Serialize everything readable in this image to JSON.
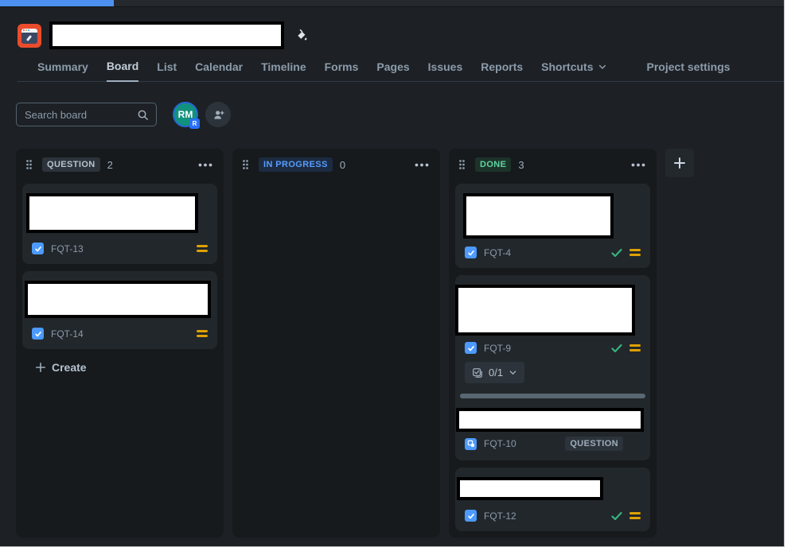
{
  "header": {
    "tabs": [
      {
        "label": "Summary"
      },
      {
        "label": "Board"
      },
      {
        "label": "List"
      },
      {
        "label": "Calendar"
      },
      {
        "label": "Timeline"
      },
      {
        "label": "Forms"
      },
      {
        "label": "Pages"
      },
      {
        "label": "Issues"
      },
      {
        "label": "Reports"
      },
      {
        "label": "Shortcuts"
      },
      {
        "label": "Project settings"
      }
    ],
    "active_tab": "Board"
  },
  "toolbar": {
    "search_placeholder": "Search board",
    "avatar_initials": "RM",
    "avatar_badge": "R"
  },
  "board": {
    "columns": [
      {
        "name": "QUESTION",
        "count": "2",
        "create_label": "Create",
        "cards": [
          {
            "key": "FQT-13",
            "type": "task",
            "priority": "medium"
          },
          {
            "key": "FQT-14",
            "type": "task",
            "priority": "medium"
          }
        ]
      },
      {
        "name": "IN PROGRESS",
        "count": "0",
        "cards": []
      },
      {
        "name": "DONE",
        "count": "3",
        "cards": [
          {
            "key": "FQT-4",
            "type": "task",
            "priority": "medium",
            "resolved": true
          },
          {
            "key": "FQT-9",
            "type": "task",
            "priority": "medium",
            "resolved": true,
            "subtask_counter": "0/1",
            "subtask": {
              "key": "FQT-10",
              "type": "subtask",
              "status": "QUESTION"
            }
          },
          {
            "key": "FQT-12",
            "type": "task",
            "priority": "medium",
            "resolved": true
          }
        ]
      }
    ]
  },
  "colors": {
    "browser_tab_accent": "#4d90f0",
    "in_progress_text": "#579dff",
    "done_text": "#5fd3a2",
    "priority_medium": "#dfa100",
    "task_blue": "#4c9aff",
    "done_check": "#36b37e",
    "card_bg": "#22272b",
    "column_bg": "#161a1d",
    "page_bg": "#1d2125"
  }
}
